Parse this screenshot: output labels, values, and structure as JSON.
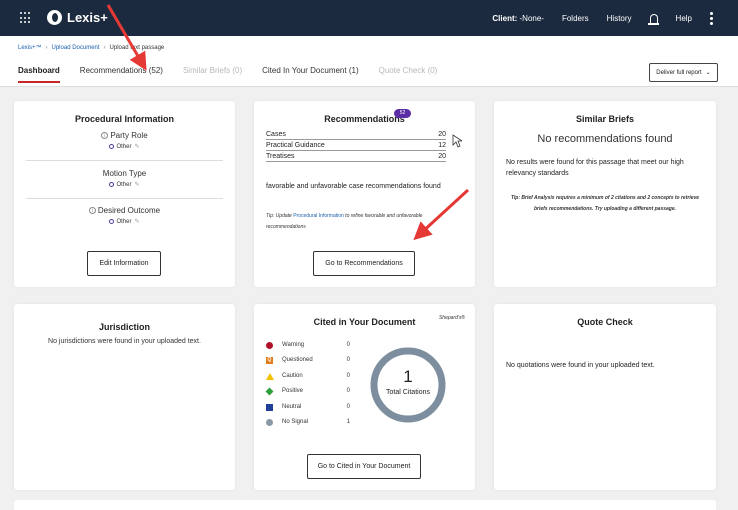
{
  "app": {
    "logo_text": "Lexis+",
    "client_label": "Client:",
    "client_value": "-None-",
    "nav": [
      "Folders",
      "History",
      "Help"
    ]
  },
  "breadcrumb": [
    "Lexis+™",
    "Upload Document",
    "Upload text passage"
  ],
  "tabs": [
    {
      "label": "Dashboard"
    },
    {
      "label": "Recommendations",
      "count": "(52)"
    },
    {
      "label": "Similar Briefs",
      "count": "(0)"
    },
    {
      "label": "Cited In Your Document",
      "count": "(1)"
    },
    {
      "label": "Quote Check",
      "count": "(0)"
    }
  ],
  "deliver_button": "Deliver full report",
  "procedural": {
    "title": "Procedural Information",
    "sections": [
      {
        "label": "Party Role",
        "value": "Other"
      },
      {
        "label": "Motion Type",
        "value": "Other"
      },
      {
        "label": "Desired Outcome",
        "value": "Other"
      }
    ],
    "button": "Edit Information"
  },
  "recommendations": {
    "title": "Recommendations",
    "badge": "52",
    "rows": [
      {
        "label": "Cases",
        "value": "20"
      },
      {
        "label": "Practical Guidance",
        "value": "12"
      },
      {
        "label": "Treatises",
        "value": "20"
      }
    ],
    "description": "favorable and unfavorable case recommendations found",
    "tip_prefix": "Tip: Update ",
    "tip_link": "Procedural Information",
    "tip_suffix": " to refine favorable and unfavorable recommendations",
    "button": "Go to Recommendations"
  },
  "similar_briefs": {
    "title": "Similar Briefs",
    "heading": "No recommendations found",
    "text": "No results were found for this passage that meet our high relevancy standards",
    "tip": "Tip: Brief Analysis requires a minimum of 2 citations and 2 concepts to retrieve briefs recommendations. Try uploading a different passage."
  },
  "jurisdiction": {
    "title": "Jurisdiction",
    "text": "No jurisdictions were found in your uploaded text."
  },
  "cited": {
    "title": "Cited in Your Document",
    "brand": "Shepard's®",
    "signals": [
      {
        "name": "Warning",
        "count": "0",
        "color": "#b0102a",
        "shape": "circle"
      },
      {
        "name": "Questioned",
        "count": "0",
        "color": "#e07b1a",
        "shape": "square-q"
      },
      {
        "name": "Caution",
        "count": "0",
        "color": "#f2c200",
        "shape": "triangle"
      },
      {
        "name": "Positive",
        "count": "0",
        "color": "#2e9e3a",
        "shape": "diamond"
      },
      {
        "name": "Neutral",
        "count": "0",
        "color": "#1f3f99",
        "shape": "square"
      },
      {
        "name": "No Signal",
        "count": "1",
        "color": "#8a98a6",
        "shape": "circle-slash"
      }
    ],
    "total": "1",
    "total_label": "Total Citations",
    "button": "Go to Cited in Your Document"
  },
  "quote_check": {
    "title": "Quote Check",
    "text": "No quotations were found in your uploaded text."
  },
  "colors": {
    "topbar": "#1c2a3f",
    "active_tab": "#c62828",
    "badge": "#5b2ea6",
    "arrow": "#e53935",
    "ring": "#7d8f9f"
  }
}
